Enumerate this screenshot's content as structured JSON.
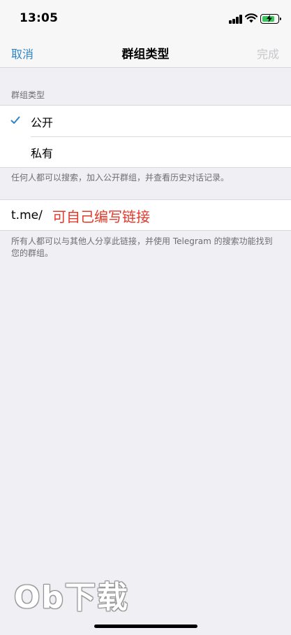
{
  "status_bar": {
    "time": "13:05"
  },
  "nav": {
    "cancel_label": "取消",
    "title": "群组类型",
    "done_label": "完成"
  },
  "group_type": {
    "header": "群组类型",
    "options": [
      {
        "label": "公开",
        "selected": true
      },
      {
        "label": "私有",
        "selected": false
      }
    ],
    "footer": "任何人都可以搜索，加入公开群组，并查看历史对话记录。"
  },
  "link": {
    "prefix": "t.me/",
    "value": "",
    "annotation": "可自己编写链接",
    "footer": "所有人都可以与其他人分享此链接，并使用 Telegram 的搜索功能找到您的群组。"
  },
  "watermark": "Ob下载",
  "colors": {
    "accent": "#2d84c9",
    "annotation": "#e0392a",
    "background": "#efeff4",
    "disabled": "#c7c7cc"
  }
}
